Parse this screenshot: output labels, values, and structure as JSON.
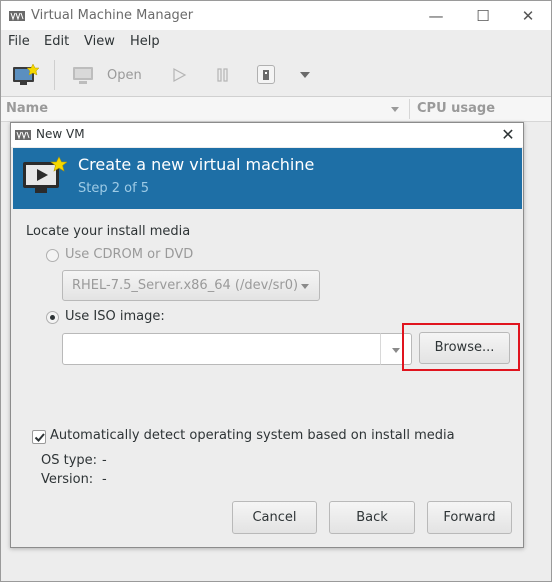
{
  "window": {
    "title": "Virtual Machine Manager",
    "controls": {
      "minimize": "—",
      "maximize": "☐",
      "close": "✕"
    }
  },
  "menu": [
    "File",
    "Edit",
    "View",
    "Help"
  ],
  "toolbar": {
    "open_label": "Open"
  },
  "list_header": {
    "name": "Name",
    "cpu": "CPU usage"
  },
  "dialog": {
    "title": "New VM",
    "close": "✕",
    "banner_title": "Create a new virtual machine",
    "banner_step": "Step 2 of 5",
    "section_label": "Locate your install media",
    "cdrom_label": "Use CDROM or DVD",
    "cdrom_selected": "RHEL-7.5_Server.x86_64 (/dev/sr0)",
    "iso_label": "Use ISO image:",
    "iso_value": "",
    "browse_label": "Browse...",
    "autodetect_label": "Automatically detect operating system based on install media",
    "os_type_label": "OS type:",
    "os_type_value": "-",
    "version_label": "Version:",
    "version_value": "-",
    "cancel_label": "Cancel",
    "back_label": "Back",
    "forward_label": "Forward"
  },
  "colors": {
    "banner": "#1e6fa6",
    "highlight": "#e0141e"
  }
}
